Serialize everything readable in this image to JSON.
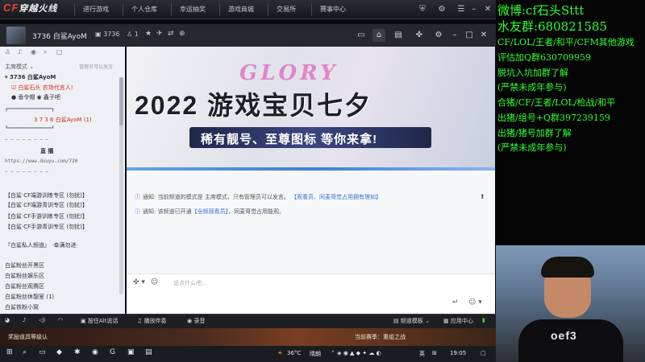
{
  "topbar": {
    "logo_main": "CF",
    "logo_sub": "穿越火线",
    "tabs": [
      "进行游戏",
      "个人仓库",
      "幸运抽奖",
      "游戏商城",
      "交易所",
      "赛事中心"
    ]
  },
  "app_header": {
    "channel_title": "3736 白鲨AyoM",
    "channel_id": "3736",
    "member_count": "1"
  },
  "sidebar": {
    "mode_label": "主席模式 ⌄",
    "admin_hint": "管理员可以发言",
    "channel_header": "▾ 3736 白鲨AyoM",
    "lines": [
      "☑ 白鲨石头 农场代言人!",
      "● 香令帽 ◉ 鑫子吧",
      "┏━━━━━━━━━━━━━━━┓",
      "3 7 3 6 白鲨AyoM (1)",
      "┗━━━━━━━━━━━━━━━┛",
      "— — — — — — — —",
      "直  播",
      "https://www.douyu.com/720",
      "— — — — — — — —",
      "【白鲨·CF端游训练专区 (勿扰)】",
      "【白鲨·CF端游青训专区 (勿扰)】",
      "【白鲨·CF手游训练专区 (勿扰)】",
      "【白鲨·CF手游青训专区 (勿扰)】",
      "『白鲨私人频道』  ·幸满勿进·",
      "白鲨粉丝开黑区",
      "白鲨粉丝娱乐区",
      "白鲨粉丝观赛区",
      "白鲨粉丝休憩室 (1)",
      "白鲨铁粉小窝"
    ]
  },
  "banner": {
    "script_text": "GLORY",
    "title": "2022 游戏宝贝七夕",
    "subtitle": "稀有靓号、至尊图标 等你来拿!"
  },
  "notices": [
    {
      "label": "通知:",
      "text": "当前频道的模式是 主席模式，只有管理员可以发言。",
      "highlight": "【观看员、同麦哥觉占用拥有理如】"
    },
    {
      "label": "通知:",
      "text": "该频道已开通",
      "highlight": "【全频观看员】",
      "text2": "，同麦哥觉占用能观。"
    }
  ],
  "input": {
    "placeholder": "说点什么吧..."
  },
  "voicebar": {
    "alt_talk": "按住Alt说话",
    "play_music": "播放伴奏",
    "record": "录音",
    "channel_template": "频道模板 ⌄",
    "app_center": "应用中心"
  },
  "gamestrip": {
    "left": "奖励道具等级认",
    "right": "当前赛季：重组之战"
  },
  "taskbar": {
    "temperature": "36°C",
    "weather": "晴朗",
    "ime": "英",
    "clock": "19:05"
  },
  "overlay": {
    "lines": [
      "微博:cf石头Sttt",
      "水友群:680821585",
      "CF/LOL/王者/和平/CFM其他游戏",
      "评估加Q群630709959",
      "脱坑入坑加群了解",
      "(严禁未成年参与)",
      "合猪/CF/王者/LOL/枪战/和平",
      "出猪/组号+Q群397239159",
      "出猪/猪号加群了解",
      "(严禁未成年参与)"
    ]
  },
  "webcam": {
    "shirt_print": "oef3"
  },
  "colors": {
    "overlay_text": "#2fff2f",
    "logo_red": "#e8412c",
    "notice_blue": "#3b74d0"
  }
}
